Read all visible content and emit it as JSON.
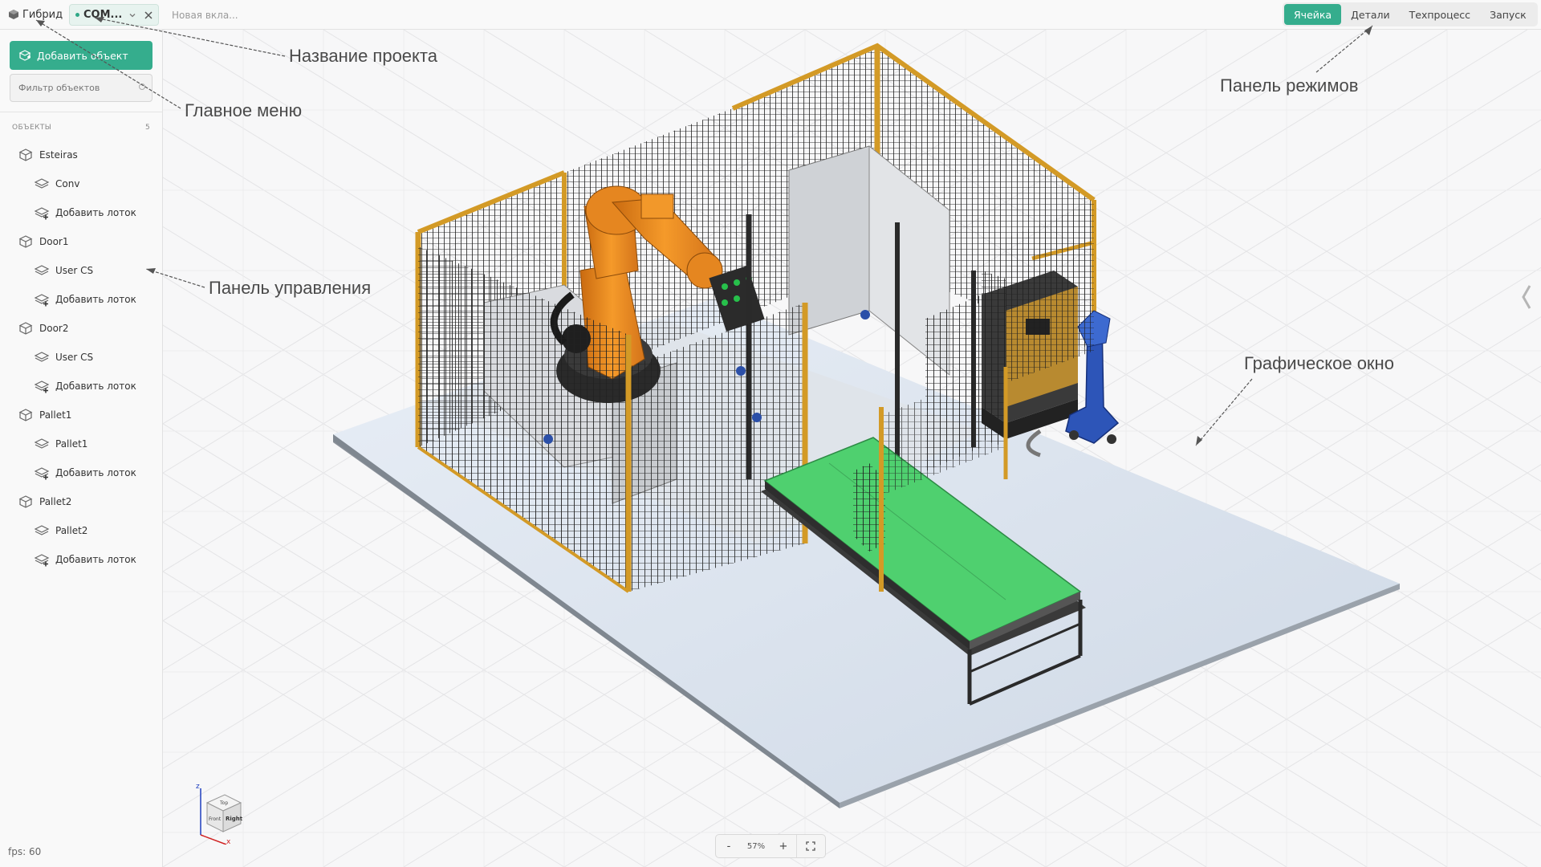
{
  "topbar": {
    "main_menu_label": "Гибрид",
    "project_tab": "COM...",
    "new_tab_placeholder": "Новая вкла...",
    "modes": [
      {
        "label": "Ячейка",
        "active": true
      },
      {
        "label": "Детали",
        "active": false
      },
      {
        "label": "Техпроцесс",
        "active": false
      },
      {
        "label": "Запуск",
        "active": false
      }
    ]
  },
  "sidebar": {
    "add_object_label": "Добавить объект",
    "filter_placeholder": "Фильтр объектов",
    "section_label": "ОБЪЕКТЫ",
    "section_count": "5",
    "tree": [
      {
        "label": "Esteiras",
        "level": 0,
        "icon": "object-cube-icon"
      },
      {
        "label": "Conv",
        "level": 1,
        "icon": "layer-icon"
      },
      {
        "label": "Добавить лоток",
        "level": 1,
        "icon": "add-tray-icon"
      },
      {
        "label": "Door1",
        "level": 0,
        "icon": "object-cube-icon"
      },
      {
        "label": "User CS",
        "level": 1,
        "icon": "layer-icon"
      },
      {
        "label": "Добавить лоток",
        "level": 1,
        "icon": "add-tray-icon"
      },
      {
        "label": "Door2",
        "level": 0,
        "icon": "object-cube-icon"
      },
      {
        "label": "User CS",
        "level": 1,
        "icon": "layer-icon"
      },
      {
        "label": "Добавить лоток",
        "level": 1,
        "icon": "add-tray-icon"
      },
      {
        "label": "Pallet1",
        "level": 0,
        "icon": "object-cube-icon"
      },
      {
        "label": "Pallet1",
        "level": 1,
        "icon": "layer-icon"
      },
      {
        "label": "Добавить лоток",
        "level": 1,
        "icon": "add-tray-icon"
      },
      {
        "label": "Pallet2",
        "level": 0,
        "icon": "object-cube-icon"
      },
      {
        "label": "Pallet2",
        "level": 1,
        "icon": "layer-icon"
      },
      {
        "label": "Добавить лоток",
        "level": 1,
        "icon": "add-tray-icon"
      }
    ],
    "fps": "fps: 60"
  },
  "viewport": {
    "zoom_out": "-",
    "zoom_level": "57%",
    "zoom_in": "+",
    "viewcube": {
      "top": "Top",
      "front": "Front",
      "right": "Right",
      "axis_z": "z",
      "axis_x": "x"
    }
  },
  "annotations": {
    "project_name": "Название проекта",
    "main_menu": "Главное меню",
    "mode_panel": "Панель режимов",
    "control_panel": "Панель управления",
    "graphics_window": "Графическое окно"
  },
  "colors": {
    "accent": "#35ad8d",
    "robot": "#f08a1c",
    "conveyor_belt": "#4fd06f",
    "fence_frame": "#d39a26",
    "controller": "#2d55b8"
  }
}
